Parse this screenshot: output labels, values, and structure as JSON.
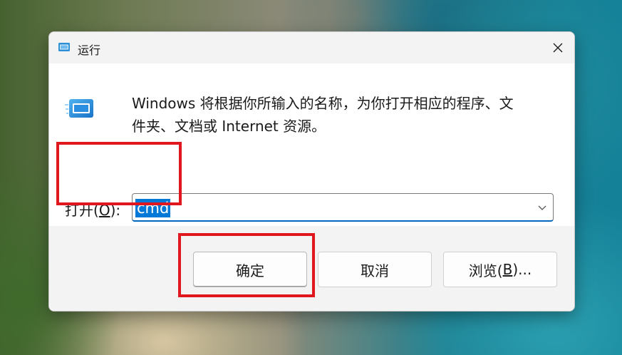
{
  "window": {
    "title": "运行",
    "title_icon": "run-icon",
    "close_icon": "close-icon"
  },
  "main": {
    "icon": "run-icon",
    "description_line1": "Windows 将根据你所输入的名称，为你打开相应的程序、文",
    "description_line2": "件夹、文档或 Internet 资源。",
    "open_label_prefix": "打开(",
    "open_label_key": "O",
    "open_label_suffix": "):",
    "command_value": "cmd",
    "dropdown_icon": "chevron-down-icon"
  },
  "buttons": {
    "ok_label": "确定",
    "cancel_label": "取消",
    "browse_label_prefix": "浏览(",
    "browse_label_key": "B",
    "browse_label_suffix": ")..."
  },
  "colors": {
    "accent": "#0078d7",
    "highlight_box": "#e0171f",
    "selection_text": "#ffffff"
  }
}
